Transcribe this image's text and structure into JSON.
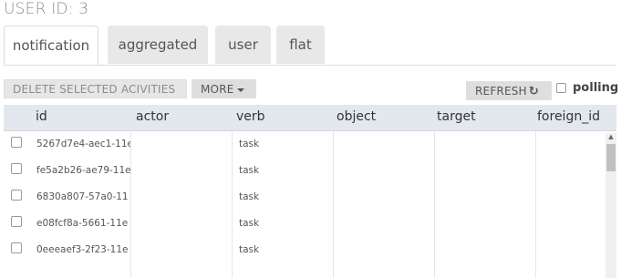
{
  "header": {
    "title": "USER ID: 3"
  },
  "tabs": [
    {
      "label": "notification",
      "active": true
    },
    {
      "label": "aggregated",
      "active": false
    },
    {
      "label": "user",
      "active": false
    },
    {
      "label": "flat",
      "active": false
    }
  ],
  "toolbar": {
    "delete_label": "DELETE SELECTED ACIVITIES",
    "more_label": "MORE",
    "refresh_label": "REFRESH",
    "refresh_icon": "↻",
    "polling_label": "polling"
  },
  "table": {
    "columns": [
      "id",
      "actor",
      "verb",
      "object",
      "target",
      "foreign_id"
    ],
    "rows": [
      {
        "id": "5267d7e4-aec1-11e",
        "actor": "",
        "verb": "task"
      },
      {
        "id": "fe5a2b26-ae79-11e",
        "actor": "",
        "verb": "task"
      },
      {
        "id": "6830a807-57a0-11",
        "actor": "",
        "verb": "task"
      },
      {
        "id": "e08fcf8a-5661-11e",
        "actor": "",
        "verb": "task"
      },
      {
        "id": "0eeeaef3-2f23-11e",
        "actor": "",
        "verb": "task"
      }
    ]
  },
  "colors": {
    "header_bg": "#e2e8ee",
    "tab_bg": "#e8e8e8",
    "button_bg": "#e6e6e6"
  }
}
